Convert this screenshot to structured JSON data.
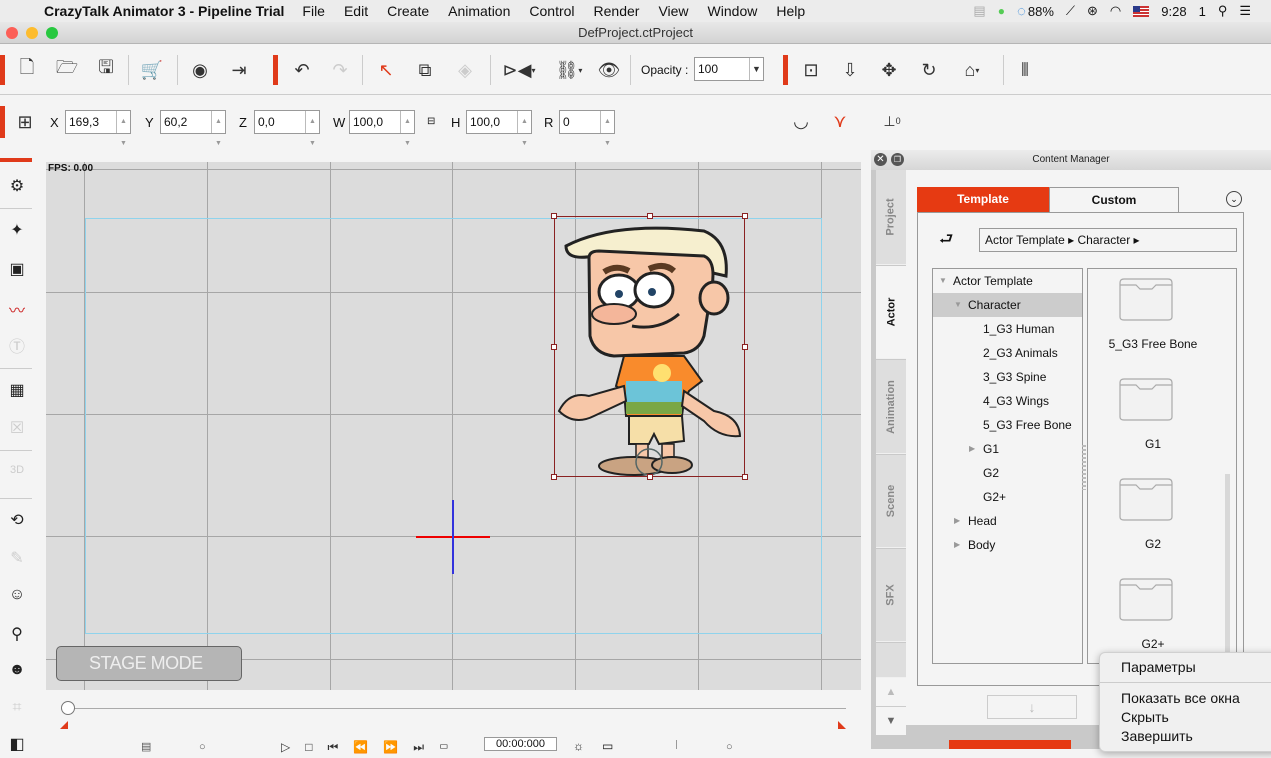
{
  "menubar": {
    "app_name": "CrazyTalk Animator 3 - Pipeline Trial",
    "items": [
      "File",
      "Edit",
      "Create",
      "Animation",
      "Control",
      "Render",
      "View",
      "Window",
      "Help"
    ],
    "battery": "88%",
    "time": "9:28",
    "user": "1"
  },
  "window": {
    "title": "DefProject.ctProject"
  },
  "toolbar": {
    "opacity_label": "Opacity :",
    "opacity_value": "100"
  },
  "transform": {
    "x_label": "X",
    "x_value": "169,3",
    "y_label": "Y",
    "y_value": "60,2",
    "z_label": "Z",
    "z_value": "0,0",
    "w_label": "W",
    "w_value": "100,0",
    "h_label": "H",
    "h_value": "100,0",
    "r_label": "R",
    "r_value": "0",
    "angle_label": "0"
  },
  "stage": {
    "fps": "FPS: 0.00",
    "mode_label": "STAGE MODE"
  },
  "timeline": {
    "timecode": "00:00:000",
    "progress": 0
  },
  "content_manager": {
    "title": "Content Manager",
    "side_tabs": [
      "Project",
      "Actor",
      "Animation",
      "Scene",
      "SFX"
    ],
    "active_side_tab": "Actor",
    "tabs": [
      "Template",
      "Custom"
    ],
    "active_tab": "Template",
    "breadcrumb": "Actor Template ▸ Character ▸",
    "tree": [
      {
        "label": "Actor Template",
        "level": 0,
        "arrow": "down"
      },
      {
        "label": "Character",
        "level": 1,
        "arrow": "down",
        "selected": true
      },
      {
        "label": "1_G3 Human",
        "level": 2
      },
      {
        "label": "2_G3 Animals",
        "level": 2
      },
      {
        "label": "3_G3 Spine",
        "level": 2
      },
      {
        "label": "4_G3 Wings",
        "level": 2
      },
      {
        "label": "5_G3 Free Bone",
        "level": 2
      },
      {
        "label": "G1",
        "level": 2,
        "arrow": "right"
      },
      {
        "label": "G2",
        "level": 2
      },
      {
        "label": "G2+",
        "level": 2
      },
      {
        "label": "Head",
        "level": 1,
        "arrow": "right"
      },
      {
        "label": "Body",
        "level": 1,
        "arrow": "right"
      }
    ],
    "folders": [
      "5_G3 Free Bone",
      "G1",
      "G2",
      "G2+"
    ],
    "accent": "#e63a12"
  },
  "context_menu": {
    "items": [
      "Параметры",
      "Показать все окна",
      "Скрыть",
      "Завершить"
    ]
  }
}
